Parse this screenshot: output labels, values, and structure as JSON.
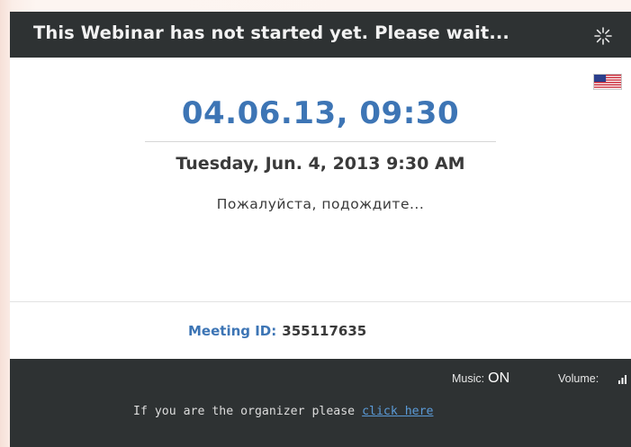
{
  "header": {
    "status_text": "This Webinar has not started yet. Please wait...",
    "spinner_icon": "loading-spinner-icon"
  },
  "language": {
    "flag_icon": "us-flag-icon"
  },
  "schedule": {
    "date_short": "04.06.13, 09:30",
    "date_long": "Tuesday, Jun. 4, 2013 9:30 AM",
    "wait_message": "Пожалуйста, подождите..."
  },
  "meeting": {
    "id_label": "Meeting ID:",
    "id_value": "355117635"
  },
  "footer": {
    "music_label": "Music:",
    "music_value": "ON",
    "volume_label": "Volume:",
    "volume_icon": "volume-bars-icon",
    "organizer_text": "If you are the organizer please",
    "organizer_link": "click here"
  },
  "colors": {
    "accent_blue": "#3d75b5",
    "dark_bar": "#2e3233",
    "link_blue": "#5b9bd8"
  }
}
